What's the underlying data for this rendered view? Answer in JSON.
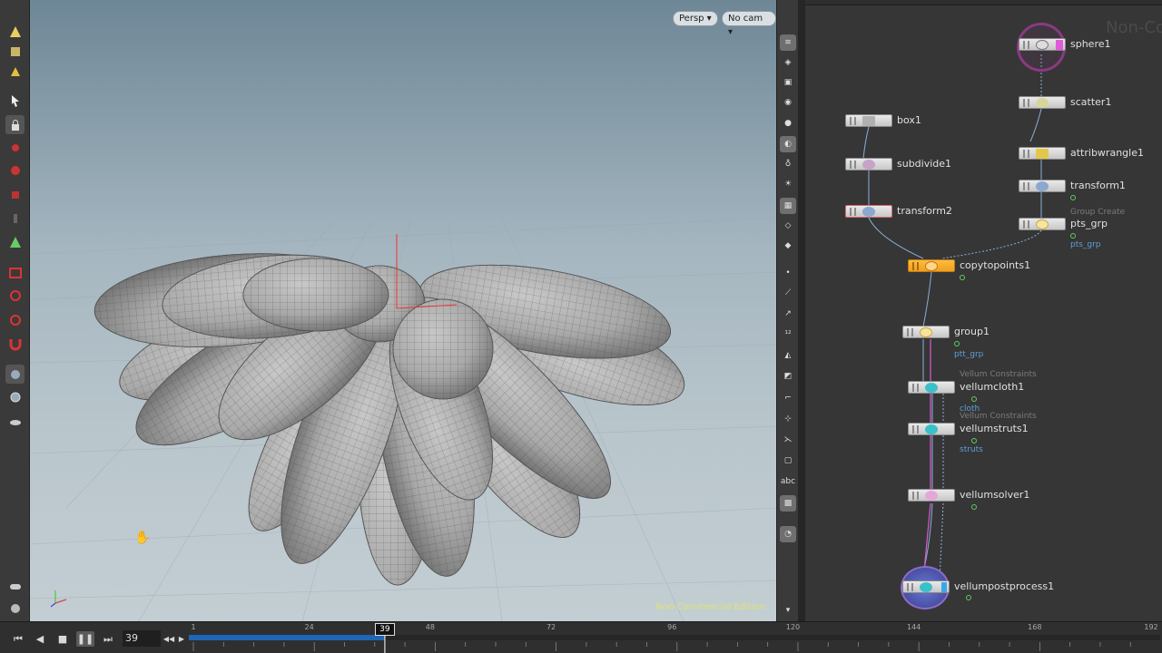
{
  "viewport": {
    "persp_label": "Persp",
    "cam_label": "No cam",
    "watermark": "Non-Commercial Edition"
  },
  "network": {
    "watermark": "Non-Co",
    "nodes": [
      {
        "name": "sphere1"
      },
      {
        "name": "scatter1"
      },
      {
        "name": "box1"
      },
      {
        "name": "attribwrangle1"
      },
      {
        "name": "subdivide1"
      },
      {
        "name": "transform1"
      },
      {
        "name": "transform2"
      },
      {
        "name": "pts_grp",
        "subtitle": "Group Create",
        "group": "pts_grp"
      },
      {
        "name": "copytopoints1"
      },
      {
        "name": "group1",
        "group": "ptt_grp"
      },
      {
        "name": "vellumcloth1",
        "subtitle": "Vellum Constraints",
        "group": "cloth"
      },
      {
        "name": "vellumstruts1",
        "subtitle": "Vellum Constraints",
        "group": "struts"
      },
      {
        "name": "vellumsolver1"
      },
      {
        "name": "vellumpostprocess1"
      }
    ]
  },
  "timeline": {
    "current_frame": "39",
    "ticks": [
      "1",
      "24",
      "48",
      "72",
      "96",
      "120",
      "144",
      "168",
      "192"
    ],
    "range_end": 192
  },
  "colors": {
    "accent_orange": "#f5a524",
    "playhead_blue": "#1f66b5",
    "network_bg": "#363636"
  }
}
